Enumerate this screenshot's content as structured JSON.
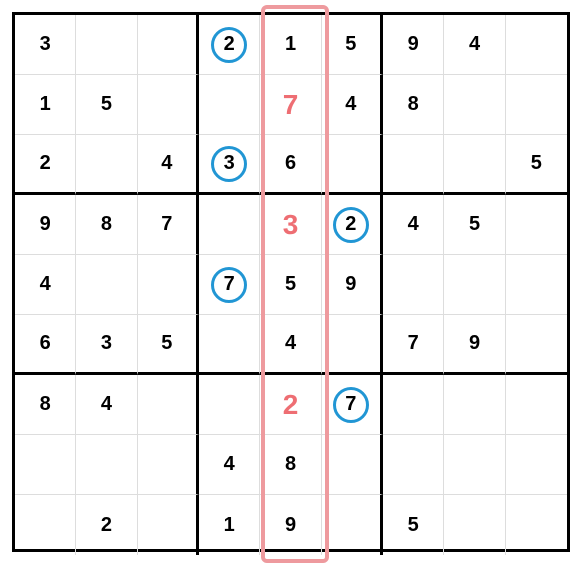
{
  "sudoku": {
    "grid": [
      [
        {
          "v": "3"
        },
        {
          "v": ""
        },
        {
          "v": ""
        },
        {
          "v": "2",
          "c": true
        },
        {
          "v": "1"
        },
        {
          "v": "5"
        },
        {
          "v": "9"
        },
        {
          "v": "4"
        },
        {
          "v": ""
        }
      ],
      [
        {
          "v": "1"
        },
        {
          "v": "5"
        },
        {
          "v": ""
        },
        {
          "v": ""
        },
        {
          "v": "7",
          "h": true
        },
        {
          "v": "4"
        },
        {
          "v": "8"
        },
        {
          "v": ""
        },
        {
          "v": ""
        }
      ],
      [
        {
          "v": "2"
        },
        {
          "v": ""
        },
        {
          "v": "4"
        },
        {
          "v": "3",
          "c": true
        },
        {
          "v": "6"
        },
        {
          "v": ""
        },
        {
          "v": ""
        },
        {
          "v": ""
        },
        {
          "v": "5"
        }
      ],
      [
        {
          "v": "9"
        },
        {
          "v": "8"
        },
        {
          "v": "7"
        },
        {
          "v": ""
        },
        {
          "v": "3",
          "h": true
        },
        {
          "v": "2",
          "c": true
        },
        {
          "v": "4"
        },
        {
          "v": "5"
        },
        {
          "v": ""
        }
      ],
      [
        {
          "v": "4"
        },
        {
          "v": ""
        },
        {
          "v": ""
        },
        {
          "v": "7",
          "c": true
        },
        {
          "v": "5"
        },
        {
          "v": "9"
        },
        {
          "v": ""
        },
        {
          "v": ""
        },
        {
          "v": ""
        }
      ],
      [
        {
          "v": "6"
        },
        {
          "v": "3"
        },
        {
          "v": "5"
        },
        {
          "v": ""
        },
        {
          "v": "4"
        },
        {
          "v": ""
        },
        {
          "v": "7"
        },
        {
          "v": "9"
        },
        {
          "v": ""
        }
      ],
      [
        {
          "v": "8"
        },
        {
          "v": "4"
        },
        {
          "v": ""
        },
        {
          "v": ""
        },
        {
          "v": "2",
          "h": true
        },
        {
          "v": "7",
          "c": true
        },
        {
          "v": ""
        },
        {
          "v": ""
        },
        {
          "v": ""
        }
      ],
      [
        {
          "v": ""
        },
        {
          "v": ""
        },
        {
          "v": ""
        },
        {
          "v": "4"
        },
        {
          "v": "8"
        },
        {
          "v": ""
        },
        {
          "v": ""
        },
        {
          "v": ""
        },
        {
          "v": ""
        }
      ],
      [
        {
          "v": ""
        },
        {
          "v": "2"
        },
        {
          "v": ""
        },
        {
          "v": "1"
        },
        {
          "v": "9"
        },
        {
          "v": ""
        },
        {
          "v": "5"
        },
        {
          "v": ""
        },
        {
          "v": ""
        }
      ]
    ],
    "column_highlight": {
      "col": 4
    }
  }
}
